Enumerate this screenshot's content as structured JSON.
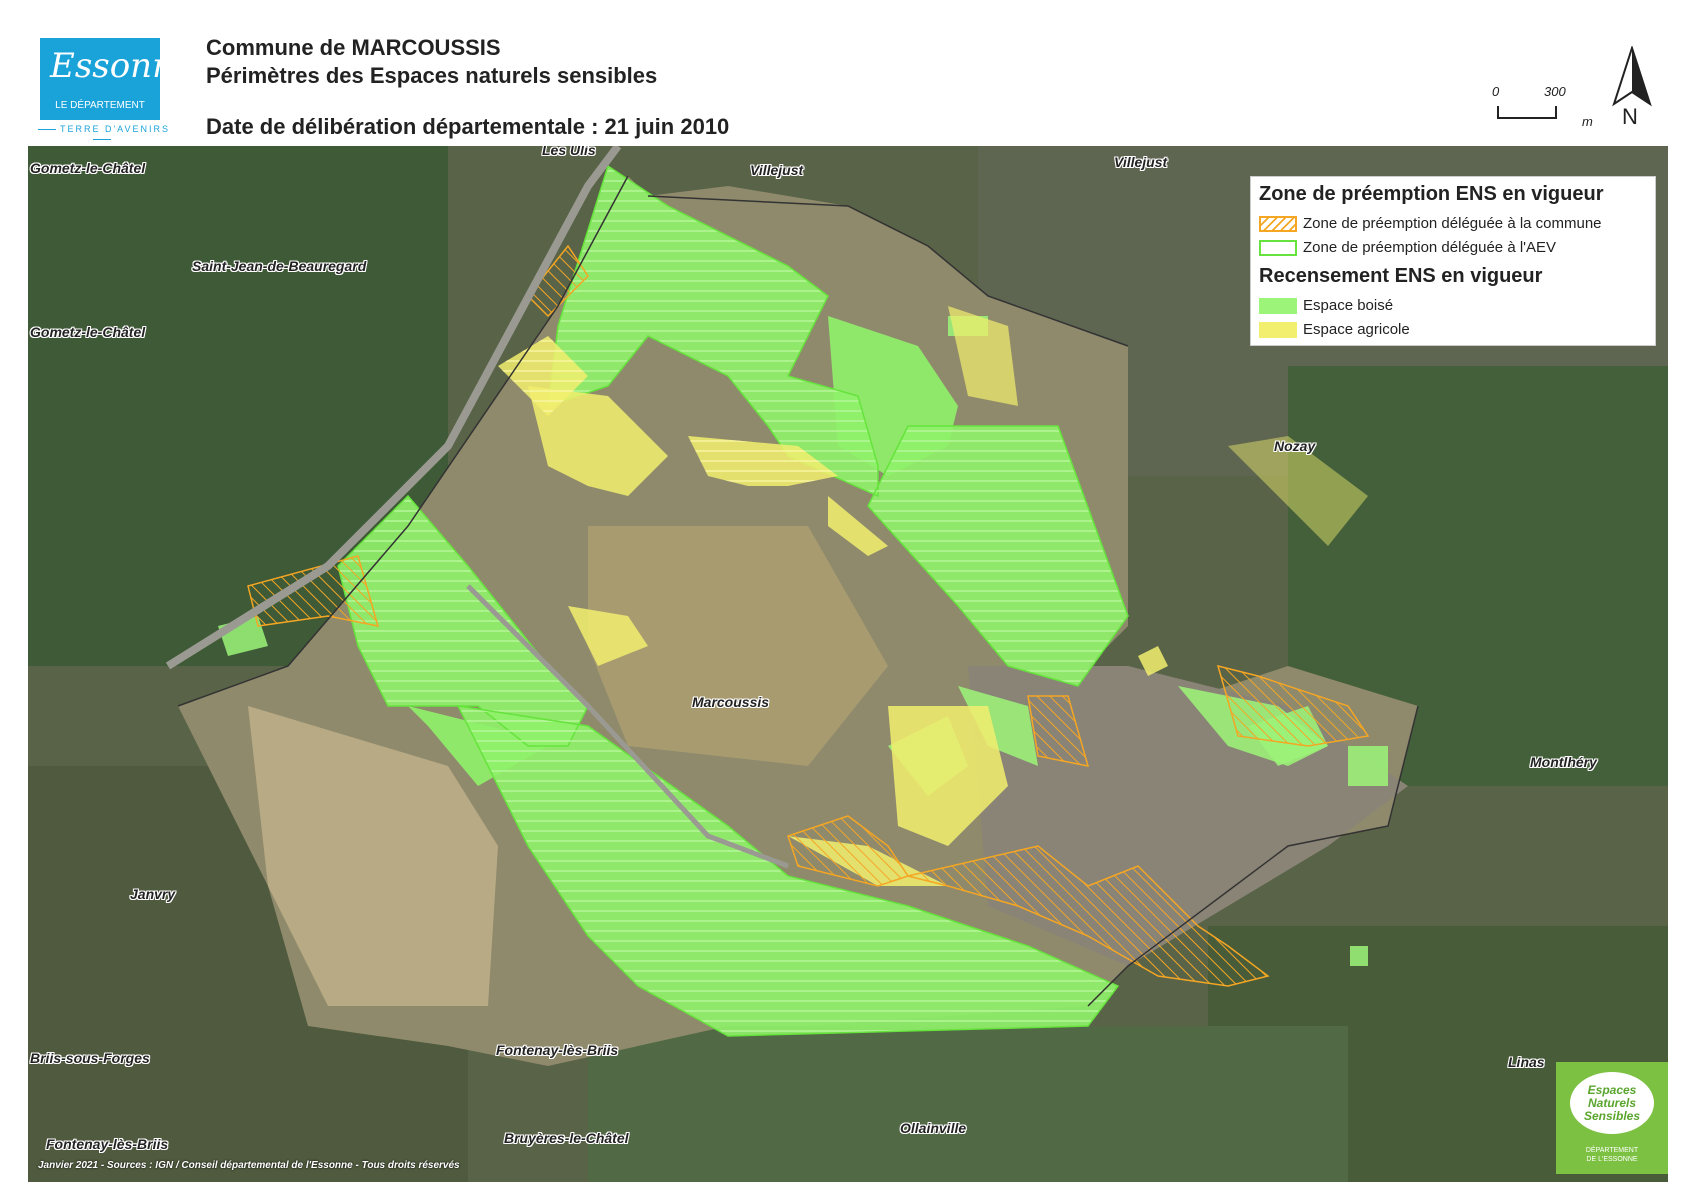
{
  "header": {
    "logo": {
      "script": "Essonne",
      "subtitle": "LE DÉPARTEMENT",
      "tagline": "TERRE D'AVENIRS"
    },
    "title_line1": "Commune de MARCOUSSIS",
    "title_line2": "Périmètres des Espaces naturels sensibles",
    "date_line": "Date de délibération départementale : 21 juin 2010",
    "scale": {
      "start": "0",
      "end": "300",
      "unit": "m"
    },
    "north": "N"
  },
  "legend": {
    "heading_zone": "Zone de préemption ENS en vigueur",
    "item_commune": "Zone de préemption déléguée à la commune",
    "item_aev": "Zone de préemption déléguée à l'AEV",
    "heading_recensement": "Recensement ENS en vigueur",
    "item_boise": "Espace boisé",
    "item_agricole": "Espace agricole",
    "colors": {
      "commune": "#f5a623",
      "aev": "#66e33c",
      "boise": "#9cf579",
      "agricole": "#f2ef6e"
    }
  },
  "places": {
    "gometz1": "Gometz-le-Châtel",
    "les_ulis": "Les Ulis",
    "villejust1": "Villejust",
    "villejust2": "Villejust",
    "saint_jean": "Saint-Jean-de-Beauregard",
    "gometz2": "Gometz-le-Châtel",
    "nozay": "Nozay",
    "marcoussis": "Marcoussis",
    "montlhery": "Montlhéry",
    "janvry": "Janvry",
    "briis": "Briis-sous-Forges",
    "fontenay1": "Fontenay-lès-Briis",
    "linas": "Linas",
    "ollainville": "Ollainville",
    "bruyeres": "Bruyères-le-Châtel",
    "fontenay2": "Fontenay-lès-Briis"
  },
  "credits": "Janvier 2021 - Sources : IGN / Conseil départemental de l'Essonne - Tous droits réservés",
  "ens_logo": {
    "line1": "Espaces",
    "line2": "Naturels",
    "line3": "Sensibles",
    "sub1": "DÉPARTEMENT",
    "sub2": "DE L'ESSONNE"
  }
}
